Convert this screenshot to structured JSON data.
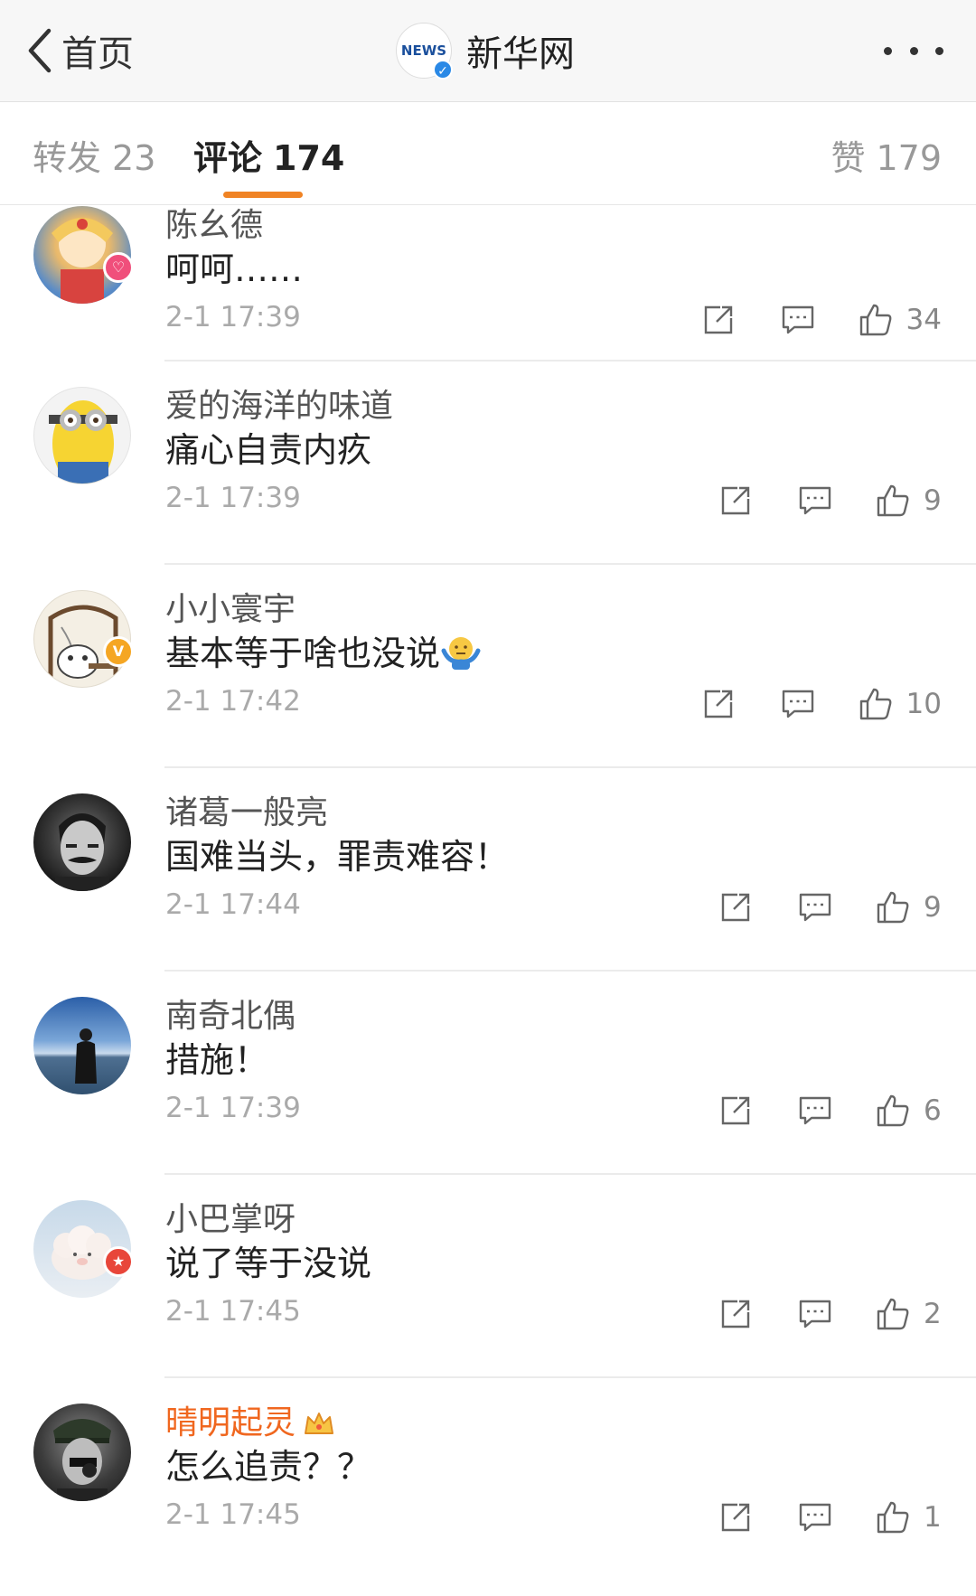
{
  "nav": {
    "back_label": "首页",
    "title": "新华网"
  },
  "tabs": {
    "repost_label": "转发",
    "repost_count": "23",
    "comment_label": "评论",
    "comment_count": "174",
    "like_label": "赞",
    "like_count": "179"
  },
  "comments": [
    {
      "username": "陈幺德",
      "content": "呵呵……",
      "time": "2-1 17:39",
      "likes": "34"
    },
    {
      "username": "爱的海洋的味道",
      "content": "痛心自责内疚",
      "time": "2-1 17:39",
      "likes": "9"
    },
    {
      "username": "小小寰宇",
      "content": "基本等于啥也没说",
      "time": "2-1 17:42",
      "likes": "10"
    },
    {
      "username": "诸葛一般亮",
      "content": "国难当头，罪责难容！",
      "time": "2-1 17:44",
      "likes": "9"
    },
    {
      "username": "南奇北偶",
      "content": "措施！",
      "time": "2-1 17:39",
      "likes": "6"
    },
    {
      "username": "小巴掌呀",
      "content": "说了等于没说",
      "time": "2-1 17:45",
      "likes": "2"
    },
    {
      "username": "晴明起灵",
      "content": "怎么追责？？",
      "time": "2-1 17:45",
      "likes": "1"
    }
  ],
  "colors": {
    "accent": "#f08324",
    "vip_name": "#f0671f",
    "verified_blue": "#2a89e6",
    "verified_orange": "#f5a623"
  }
}
